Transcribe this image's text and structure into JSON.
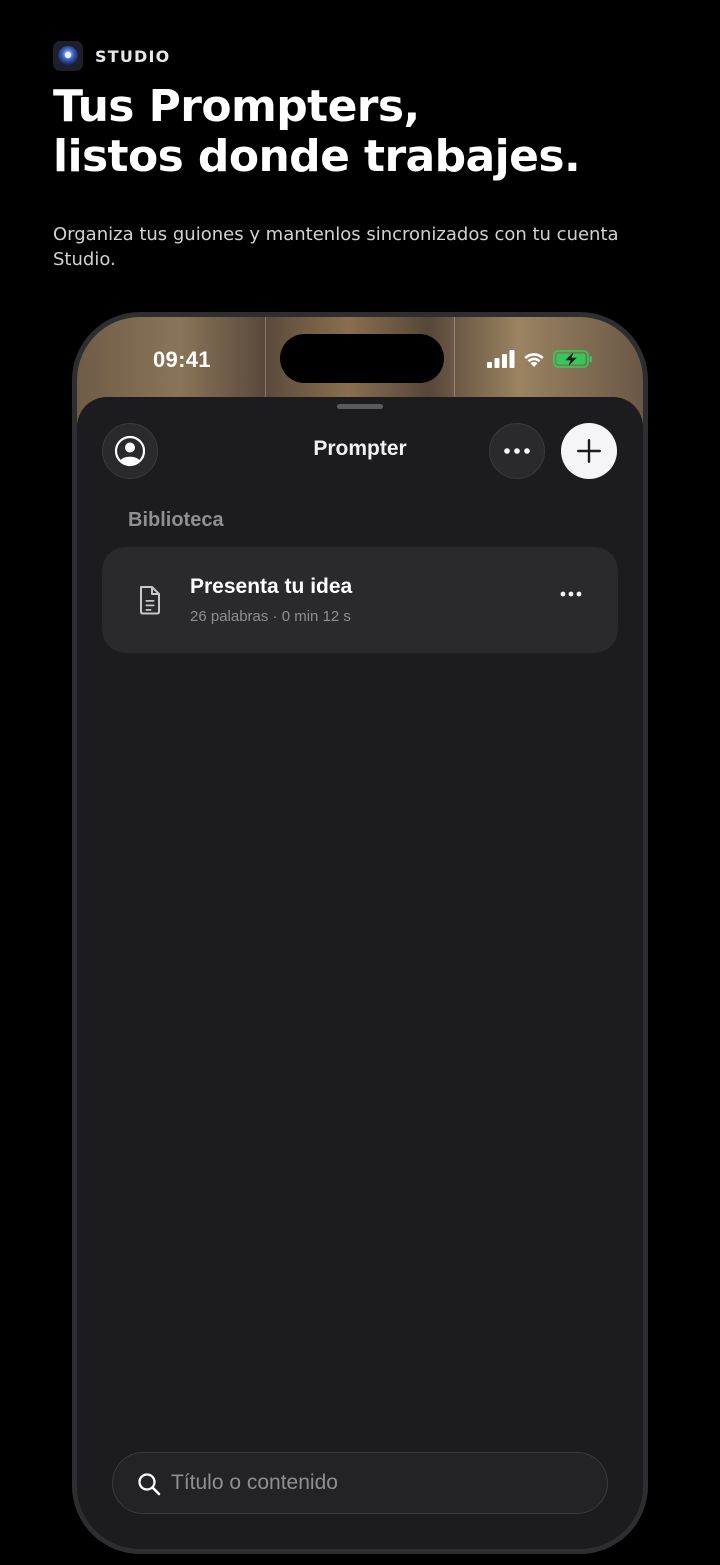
{
  "brand": {
    "label": "STUDIO"
  },
  "headline": {
    "line1": "Tus Prompters,",
    "line2": "listos donde trabajes."
  },
  "subtitle": "Organiza tus guiones y mantenlos sincronizados con tu cuenta Studio.",
  "phone": {
    "status_bar": {
      "time": "09:41",
      "battery_color": "#34c759"
    },
    "sheet": {
      "title": "Prompter",
      "section_label": "Biblioteca",
      "documents": [
        {
          "title": "Presenta tu idea",
          "meta": "26 palabras · 0 min 12 s"
        }
      ],
      "search": {
        "placeholder": "Título o contenido"
      }
    }
  }
}
